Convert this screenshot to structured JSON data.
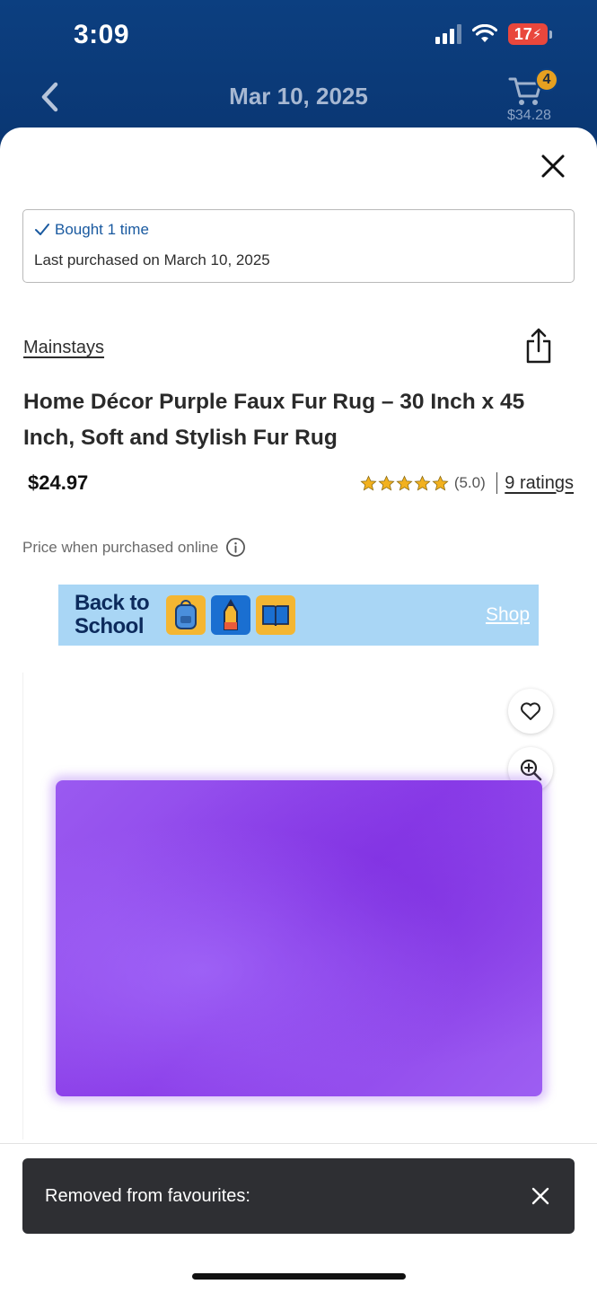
{
  "status_bar": {
    "time": "3:09",
    "battery": "17"
  },
  "header": {
    "title": "Mar 10, 2025",
    "cart_count": "4",
    "cart_total": "$34.28"
  },
  "purchase_info": {
    "bought_label": "Bought 1 time",
    "last_purchased": "Last purchased on March 10, 2025"
  },
  "product": {
    "brand": "Mainstays",
    "title": "Home Décor Purple Faux Fur Rug – 30 Inch x 45 Inch, Soft and Stylish Fur Rug",
    "price": "$24.97",
    "rating_value": "(5.0)",
    "rating_stars": 5,
    "ratings_count": "9 ratings",
    "price_note": "Price when purchased online"
  },
  "banner": {
    "title_line1": "Back to",
    "title_line2": "School",
    "cta": "Shop"
  },
  "toast": {
    "message": "Removed from favourites:"
  },
  "colors": {
    "header_bg": "#0c3f80",
    "rating_star": "#f2b11f",
    "rug": "#8a3ce8",
    "toast_bg": "#2e2f33"
  },
  "icons": [
    "back-chevron-icon",
    "cart-icon",
    "close-icon",
    "checkmark-icon",
    "share-icon",
    "star-icon",
    "info-icon",
    "heart-icon",
    "zoom-in-icon"
  ]
}
